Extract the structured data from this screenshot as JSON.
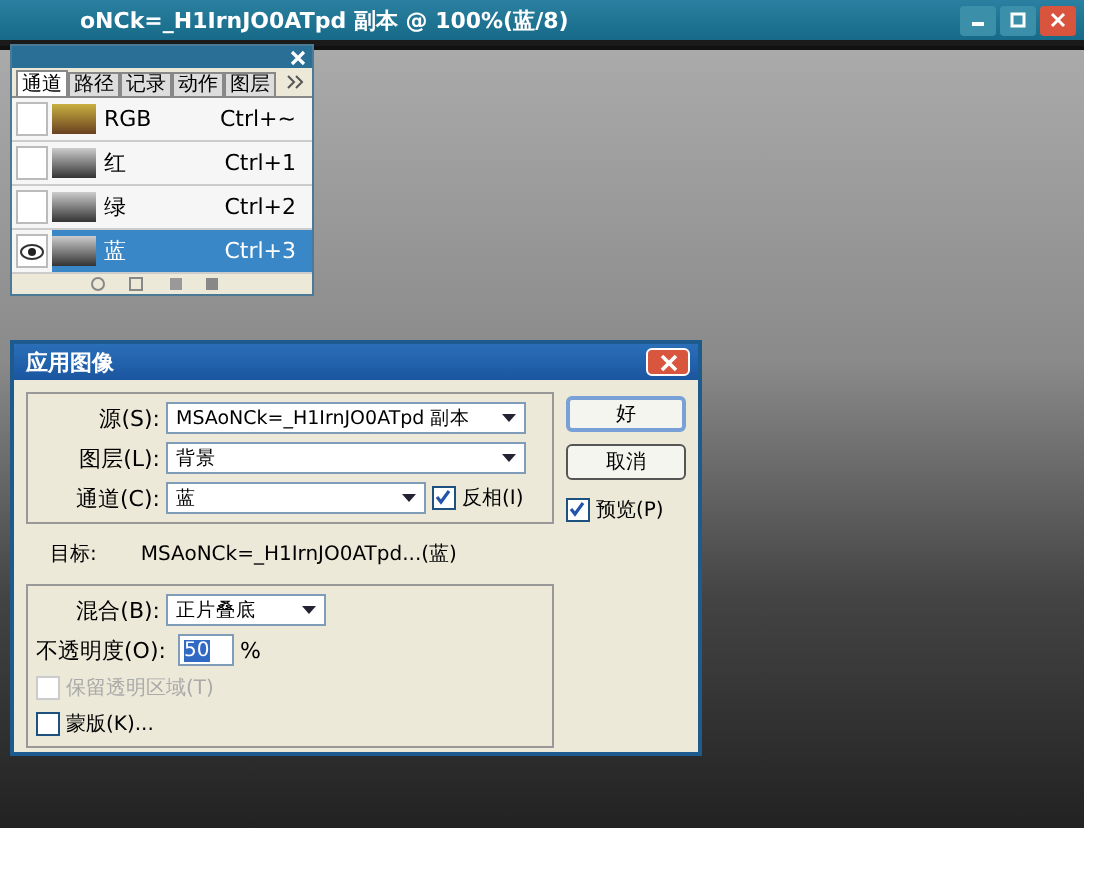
{
  "window": {
    "title": "oNCk=_H1IrnJO0ATpd 副本 @ 100%(蓝/8)"
  },
  "channels_panel": {
    "tabs": [
      {
        "label": "通道",
        "selected": true
      },
      {
        "label": "路径",
        "selected": false
      },
      {
        "label": "记录",
        "selected": false
      },
      {
        "label": "动作",
        "selected": false
      },
      {
        "label": "图层",
        "selected": false
      }
    ],
    "channels": [
      {
        "name": "RGB",
        "shortcut": "Ctrl+~",
        "visible": false,
        "selected": false
      },
      {
        "name": "红",
        "shortcut": "Ctrl+1",
        "visible": false,
        "selected": false
      },
      {
        "name": "绿",
        "shortcut": "Ctrl+2",
        "visible": false,
        "selected": false
      },
      {
        "name": "蓝",
        "shortcut": "Ctrl+3",
        "visible": true,
        "selected": true
      }
    ]
  },
  "dialog": {
    "title": "应用图像",
    "source": {
      "label": "源(S):",
      "value": "MSAoNCk=_H1IrnJO0ATpd 副本"
    },
    "layer": {
      "label": "图层(L):",
      "value": "背景"
    },
    "channel": {
      "label": "通道(C):",
      "value": "蓝"
    },
    "invert": {
      "label": "反相(I)",
      "checked": true
    },
    "target": {
      "label": "目标:",
      "value": "MSAoNCk=_H1IrnJO0ATpd...(蓝)"
    },
    "blending": {
      "label": "混合(B):",
      "value": "正片叠底"
    },
    "opacity": {
      "label": "不透明度(O):",
      "value": "50",
      "unit": "%"
    },
    "preserve_transparency": {
      "label": "保留透明区域(T)",
      "checked": false,
      "disabled": true
    },
    "mask": {
      "label": "蒙版(K)...",
      "checked": false,
      "disabled": false
    },
    "buttons": [
      "好",
      "取消"
    ],
    "preview": {
      "label": "预览(P)",
      "checked": true
    }
  }
}
